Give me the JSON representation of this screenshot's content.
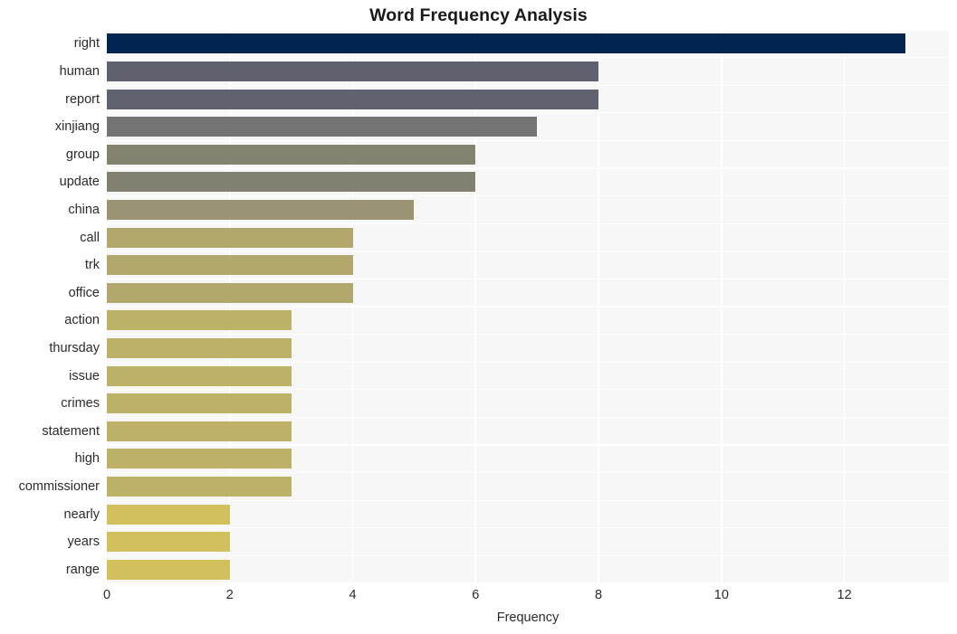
{
  "chart_data": {
    "type": "bar",
    "orientation": "horizontal",
    "title": "Word Frequency Analysis",
    "xlabel": "Frequency",
    "ylabel": "",
    "categories": [
      "right",
      "human",
      "report",
      "xinjiang",
      "group",
      "update",
      "china",
      "call",
      "trk",
      "office",
      "action",
      "thursday",
      "issue",
      "crimes",
      "statement",
      "high",
      "commissioner",
      "nearly",
      "years",
      "range"
    ],
    "values": [
      13,
      8,
      8,
      7,
      6,
      6,
      5,
      4,
      4,
      4,
      3,
      3,
      3,
      3,
      3,
      3,
      3,
      2,
      2,
      2
    ],
    "bar_colors": [
      "#00234f",
      "#60616e",
      "#61626f",
      "#737373",
      "#84836f",
      "#828071",
      "#9a9474",
      "#b2a86e",
      "#b2a86e",
      "#b2a86e",
      "#bdb168",
      "#bdb168",
      "#bdb168",
      "#bdb168",
      "#bdb168",
      "#bdb168",
      "#bdb168",
      "#d2c05e",
      "#d2c05e",
      "#d2c05e"
    ],
    "xticks": [
      0,
      2,
      4,
      6,
      8,
      10,
      12
    ],
    "xtick_labels": [
      "0",
      "2",
      "4",
      "6",
      "8",
      "10",
      "12"
    ],
    "xlim": [
      0,
      13.7
    ],
    "grid": true,
    "grid_color": "#ffffff",
    "plot_background": "#f7f7f7",
    "figure_background": "#ffffff",
    "legend": null,
    "colormap": "cividis"
  }
}
